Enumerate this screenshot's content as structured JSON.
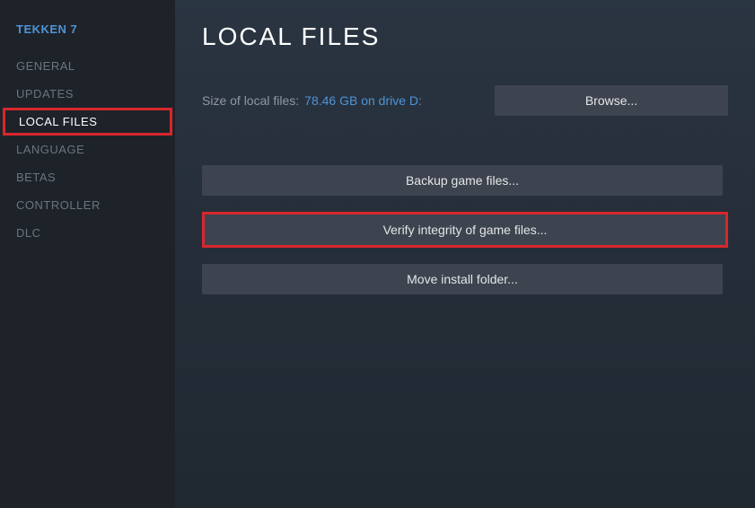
{
  "sidebar": {
    "game_title": "TEKKEN 7",
    "items": [
      {
        "label": "GENERAL"
      },
      {
        "label": "UPDATES"
      },
      {
        "label": "LOCAL FILES"
      },
      {
        "label": "LANGUAGE"
      },
      {
        "label": "BETAS"
      },
      {
        "label": "CONTROLLER"
      },
      {
        "label": "DLC"
      }
    ]
  },
  "main": {
    "page_title": "LOCAL FILES",
    "size_label": "Size of local files:",
    "size_value": "78.46 GB on drive D:",
    "browse_label": "Browse...",
    "backup_label": "Backup game files...",
    "verify_label": "Verify integrity of game files...",
    "move_label": "Move install folder..."
  }
}
